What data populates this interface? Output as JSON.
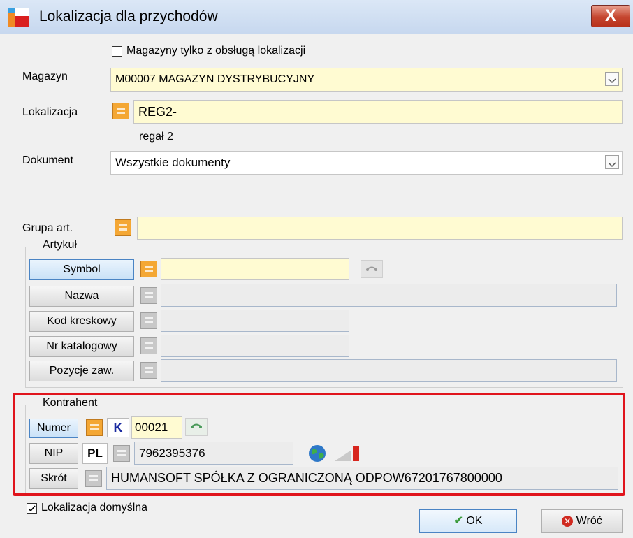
{
  "window": {
    "title": "Lokalizacja dla przychodów",
    "close_label": "X"
  },
  "filter_checkbox": {
    "label": "Magazyny tylko z obsługą lokalizacji",
    "checked": false
  },
  "magazyn": {
    "label": "Magazyn",
    "value": "M00007 MAGAZYN DYSTRYBUCYJNY"
  },
  "lokalizacja": {
    "label": "Lokalizacja",
    "value": "REG2-",
    "description": "regał 2"
  },
  "dokument": {
    "label": "Dokument",
    "value": "Wszystkie dokumenty"
  },
  "grupa": {
    "label": "Grupa art.",
    "value": ""
  },
  "artykul": {
    "legend": "Artykuł",
    "symbol_label": "Symbol",
    "nazwa_label": "Nazwa",
    "kod_label": "Kod kreskowy",
    "nr_label": "Nr katalogowy",
    "pozycje_label": "Pozycje zaw."
  },
  "kontrahent": {
    "legend": "Kontrahent",
    "numer_label": "Numer",
    "numer_prefix": "K",
    "numer_value": "00021",
    "nip_label": "NIP",
    "nip_country": "PL",
    "nip_value": "7962395376",
    "skrot_label": "Skrót",
    "skrot_value": "HUMANSOFT SPÓŁKA Z OGRANICZONĄ ODPOW67201767800000"
  },
  "default_checkbox": {
    "label": "Lokalizacja domyślna",
    "checked": true
  },
  "buttons": {
    "ok_label": "OK",
    "back_label": "Wróć"
  },
  "colors": {
    "field_bg": "#fffbd2",
    "highlight": "#e0141c",
    "accent": "#4a84c4"
  }
}
